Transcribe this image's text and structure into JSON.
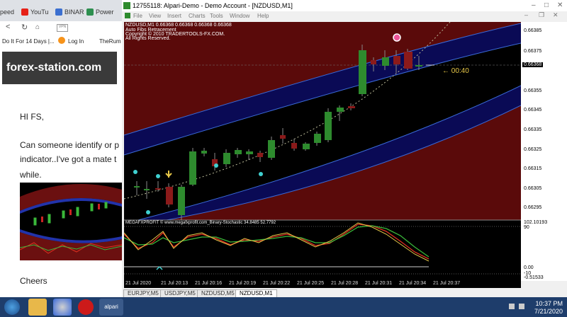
{
  "browser": {
    "tabs": [
      {
        "label": "peed"
      },
      {
        "label": "YouTu"
      },
      {
        "label": "BINAR"
      },
      {
        "label": "Power"
      }
    ],
    "bookmarks": [
      {
        "label": "Do It For 14 Days |..."
      },
      {
        "label": "Log In"
      },
      {
        "label": "TheRum"
      }
    ],
    "site_logo": "forex-station.com",
    "post": {
      "greeting": "HI FS,",
      "line1": "Can someone identify or p",
      "line2": "indicator..I've got a mate t",
      "line3": "while.",
      "closing": "Cheers"
    }
  },
  "mt4": {
    "title": "12755118: Alpari-Demo - Demo Account - [NZDUSD,M1]",
    "menu": [
      "File",
      "View",
      "Insert",
      "Charts",
      "Tools",
      "Window",
      "Help"
    ],
    "symbol_line": "NZDUSD,M1  0.66368 0.66368 0.66368 0.66368",
    "indicator_line1": "Auto Fibs Retracement",
    "indicator_line2": "Copyright © 2010 TRADERTOOLS-FX.COM.",
    "indicator_line3": "All Rights Reserved.",
    "timer": "← 00:40",
    "subwindow_label": "MEGAFXPROFIT © www.megafxprofit.com_Binary-Stochastic 34.8485 52.7792",
    "price_ticks": [
      "0.66385",
      "0.66375",
      "0.66355",
      "0.66345",
      "0.66335",
      "0.66325",
      "0.66315",
      "0.66305",
      "0.66295"
    ],
    "current_price": "0.66368",
    "sub_ticks": [
      "102.10193",
      "90",
      "0.00",
      "-10",
      "-0.51533"
    ],
    "time_labels": [
      "21 Jul 2020",
      "21 Jul 20:13",
      "21 Jul 20:16",
      "21 Jul 20:19",
      "21 Jul 20:22",
      "21 Jul 20:25",
      "21 Jul 20:28",
      "21 Jul 20:31",
      "21 Jul 20:34",
      "21 Jul 20:37"
    ],
    "chart_tabs": [
      "EURJPY,M5",
      "USDJPY,M5",
      "NZDUSD,M5",
      "NZDUSD,M1"
    ],
    "active_tab": "NZDUSD,M1"
  },
  "taskbar": {
    "app_label": "alpari",
    "time": "10:37 PM",
    "date": "7/21/2020"
  },
  "colors": {
    "up_candle": "#2e8b2e",
    "down_candle": "#8b1a1a",
    "stoch_red": "#e03020",
    "stoch_green": "#3ab83a",
    "stoch_yellow": "#e8c848"
  }
}
